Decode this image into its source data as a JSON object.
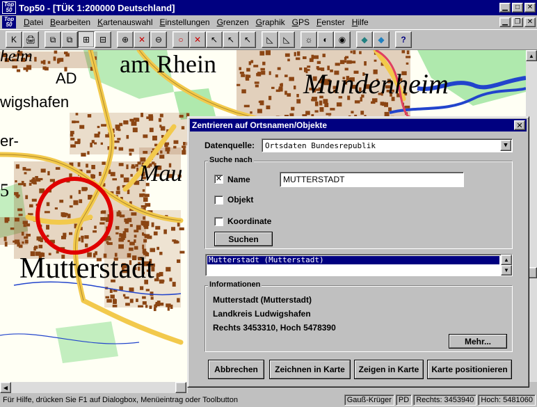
{
  "window": {
    "app_icon": [
      "Top",
      "50"
    ],
    "title": "Top50 - [TÜK 1:200000 Deutschland]"
  },
  "menu": [
    {
      "key": "D",
      "rest": "atei"
    },
    {
      "key": "B",
      "rest": "earbeiten"
    },
    {
      "key": "K",
      "rest": "artenauswahl"
    },
    {
      "key": "E",
      "rest": "instellungen"
    },
    {
      "key": "G",
      "rest": "renzen"
    },
    {
      "key": "G",
      "rest": "raphik"
    },
    {
      "key": "G",
      "rest": "PS"
    },
    {
      "key": "F",
      "rest": "enster"
    },
    {
      "key": "H",
      "rest": "ilfe"
    }
  ],
  "toolbar_icons": [
    "K",
    "🖨",
    "⧉",
    "⧉",
    "⊞",
    "⊟",
    "⊕",
    "✕",
    "⊖",
    "○",
    "✕",
    "↖",
    "↖",
    "↖",
    "◺",
    "◺",
    "☼",
    "◐",
    "◉",
    "◆",
    "◆",
    "?"
  ],
  "map_labels": {
    "am_rhein": "am Rhein",
    "heim": "heim",
    "ad": "AD",
    "wigshafen": "wigshafen",
    "er": "er-",
    "mundenheim": "Mundenheim",
    "mau": "Mau",
    "mutterstadt": "Mutterstadt",
    "five": "5"
  },
  "colors": {
    "title_bar": "#000080",
    "map_bg": "#fffff4",
    "settlement": "#8b4513",
    "road_yellow": "#f2c94c",
    "marker_red": "#e00000",
    "forest_green": "#9be39b",
    "water_blue": "#2244cc"
  },
  "dialog": {
    "title": "Zentrieren auf Ortsnamen/Objekte",
    "datenquelle_label": "Datenquelle:",
    "datenquelle_value": "Ortsdaten Bundesrepublik",
    "suche_title": "Suche nach",
    "name_label": "Name",
    "name_checked": "✕",
    "name_value": "MUTTERSTADT",
    "objekt_label": "Objekt",
    "koordinate_label": "Koordinate",
    "suchen": "Suchen",
    "result": "Mutterstadt (Mutterstadt)",
    "info_title": "Informationen",
    "info_line1": "Mutterstadt (Mutterstadt)",
    "info_line2": "Landkreis Ludwigshafen",
    "info_line3": "Rechts 3453310, Hoch 5478390",
    "mehr": "Mehr...",
    "abbrechen": "Abbrechen",
    "zeichnen": "Zeichnen in Karte",
    "zeigen": "Zeigen in Karte",
    "positionieren": "Karte positionieren"
  },
  "status": {
    "hint": "Für Hilfe, drücken Sie F1 auf Dialogbox, Menüeintrag oder Toolbutton",
    "projection": "Gauß-Krüger",
    "pd": "PD",
    "rechts": "Rechts: 3453940",
    "hoch": "Hoch: 5481060"
  }
}
